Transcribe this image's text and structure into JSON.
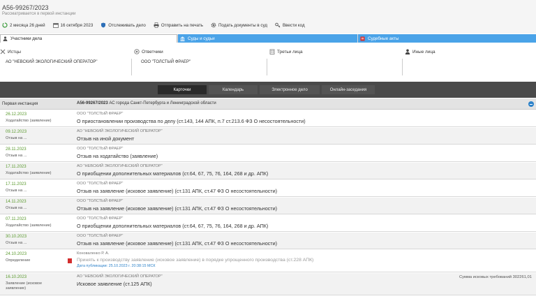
{
  "case": {
    "number": "А56-99267/2023",
    "status": "Рассматривается в первой инстанции"
  },
  "toolbar": {
    "duration": "2 месяца 26 дней",
    "date": "16 октября 2023",
    "track": "Отслеживать дело",
    "print": "Отправить на печать",
    "submit": "Подать документы в суд",
    "code": "Ввести код"
  },
  "tabs": {
    "participants": "Участники дела",
    "courts": "Суды и судьи",
    "acts": "Судебные акты"
  },
  "parties": {
    "plaintiffs": {
      "label": "Истцы",
      "value": "АО \"НЕВСКИЙ ЭКОЛОГИЧЕСКИЙ ОПЕРАТОР\""
    },
    "defendants": {
      "label": "Ответчики",
      "value": "ООО \"ТОЛСТЫЙ ФРАЕР\""
    },
    "third": {
      "label": "Третьи лица",
      "value": ""
    },
    "other": {
      "label": "Иные лица",
      "value": ""
    }
  },
  "views": {
    "cards": "Карточки",
    "calendar": "Календарь",
    "electronic": "Электронное дело",
    "online": "Онлайн-заседания"
  },
  "instance": {
    "title": "Первая инстанция",
    "case_ref": "А56-99267/2023",
    "court": "АС города Санкт-Петербурга и Ленинградской области"
  },
  "events": [
    {
      "date": "26.12.2023",
      "type": "Ходатайство (заявление)",
      "party": "ООО \"ТОЛСТЫЙ ФРАЕР\"",
      "title": "О приостановлении производства по делу (ст.143, 144 АПК, п.7 ст.213.6 ФЗ О несостоятельности)"
    },
    {
      "date": "09.12.2023",
      "type": "Отзыв на ...",
      "party": "АО \"НЕВСКИЙ ЭКОЛОГИЧЕСКИЙ ОПЕРАТОР\"",
      "title": "Отзыв на иной документ"
    },
    {
      "date": "28.11.2023",
      "type": "Отзыв на ...",
      "party": "ООО \"ТОЛСТЫЙ ФРАЕР\"",
      "title": "Отзыв на ходатайство (заявление)"
    },
    {
      "date": "17.11.2023",
      "type": "Ходатайство (заявление)",
      "party": "АО \"НЕВСКИЙ ЭКОЛОГИЧЕСКИЙ ОПЕРАТОР\"",
      "title": "О приобщении дополнительных материалов (ст.64, 67, 75, 76, 164, 268 и др. АПК)"
    },
    {
      "date": "17.11.2023",
      "type": "Отзыв на ...",
      "party": "ООО \"ТОЛСТЫЙ ФРАЕР\"",
      "title": "Отзыв на заявление (исковое заявление) (ст.131 АПК, ст.47 ФЗ О несостоятельности)"
    },
    {
      "date": "14.11.2023",
      "type": "Отзыв на ...",
      "party": "ООО \"ТОЛСТЫЙ ФРАЕР\"",
      "title": "Отзыв на заявление (исковое заявление) (ст.131 АПК, ст.47 ФЗ О несостоятельности)"
    },
    {
      "date": "07.11.2023",
      "type": "Ходатайство (заявление)",
      "party": "ООО \"ТОЛСТЫЙ ФРАЕР\"",
      "title": "О приобщении дополнительных материалов (ст.64, 67, 75, 76, 164, 268 и др. АПК)"
    },
    {
      "date": "30.10.2023",
      "type": "Отзыв на ...",
      "party": "ООО \"ТОЛСТЫЙ ФРАЕР\"",
      "title": "Отзыв на заявление (исковое заявление) (ст.131 АПК, ст.47 ФЗ О несостоятельности)"
    },
    {
      "date": "24.10.2023",
      "type": "Определение",
      "party": "Коноваленко Р. А.",
      "title": "Принять к производству заявление (исковое заявление) в порядке упрощенного производства (ст.228 АПК)",
      "published": "Дата публикации: 25.10.2023 г. 20:38:15 МСК"
    },
    {
      "date": "16.10.2023",
      "type": "Заявление (исковое заявление)",
      "party": "АО \"НЕВСКИЙ ЭКОЛОГИЧЕСКИЙ ОПЕРАТОР\"",
      "title": "Исковое заявление (ст.125 АПК)",
      "sum": "Сумма исковых требований 302261,01"
    }
  ]
}
